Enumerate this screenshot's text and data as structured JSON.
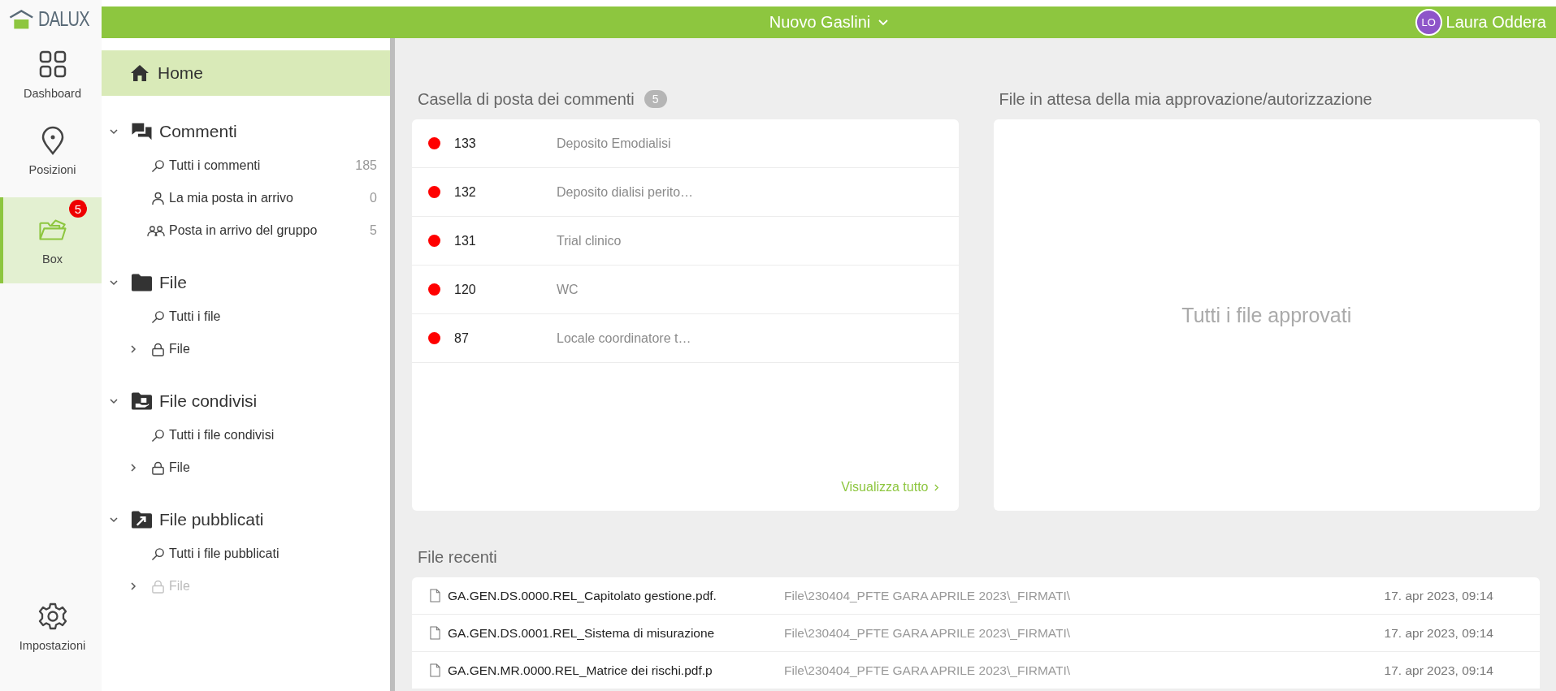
{
  "logo": "DALUX",
  "rail": {
    "items": [
      {
        "label": "Dashboard",
        "selected": false
      },
      {
        "label": "Posizioni",
        "selected": false
      },
      {
        "label": "Box",
        "selected": true,
        "badge": "5"
      }
    ],
    "settings": {
      "label": "Impostazioni"
    }
  },
  "topbar": {
    "project": "Nuovo Gaslini",
    "user": {
      "initials": "LO",
      "name": "Laura Oddera"
    }
  },
  "nav": {
    "home": {
      "label": "Home",
      "selected": true
    },
    "sections": [
      {
        "label": "Commenti",
        "expanded": true,
        "items": [
          {
            "kind": "search",
            "label": "Tutti i commenti",
            "count": "185"
          },
          {
            "kind": "person",
            "label": "La mia posta in arrivo",
            "count": "0"
          },
          {
            "kind": "group",
            "label": "Posta in arrivo del gruppo",
            "count": "5"
          }
        ]
      },
      {
        "label": "File",
        "expanded": true,
        "items": [
          {
            "kind": "search",
            "label": "Tutti i file"
          },
          {
            "kind": "folder",
            "label": "File",
            "expanded": false,
            "disabled": false
          }
        ]
      },
      {
        "label": "File condivisi",
        "expanded": true,
        "items": [
          {
            "kind": "search",
            "label": "Tutti i file condivisi"
          },
          {
            "kind": "folder",
            "label": "File",
            "expanded": false,
            "disabled": false
          }
        ]
      },
      {
        "label": "File pubblicati",
        "expanded": true,
        "items": [
          {
            "kind": "search",
            "label": "Tutti i file pubblicati"
          },
          {
            "kind": "folder",
            "label": "File",
            "expanded": false,
            "disabled": true
          }
        ]
      }
    ]
  },
  "comments": {
    "title": "Casella di posta dei commenti",
    "count": "5",
    "rows": [
      {
        "id": "133",
        "text": "Deposito Emodialisi"
      },
      {
        "id": "132",
        "text": "Deposito dialisi perito…"
      },
      {
        "id": "131",
        "text": "Trial clinico"
      },
      {
        "id": "120",
        "text": "WC"
      },
      {
        "id": "87",
        "text": "Locale coordinatore t…"
      }
    ],
    "link": "Visualizza tutto"
  },
  "approval": {
    "title": "File in attesa della mia approvazione/autorizzazione",
    "empty": "Tutti i file approvati"
  },
  "recent": {
    "title": "File recenti",
    "rows": [
      {
        "name": "GA.GEN.DS.0000.REL_Capitolato gestione.pdf.",
        "path": "File\\230404_PFTE GARA APRILE 2023\\_FIRMATI\\",
        "date": "17. apr 2023, 09:14"
      },
      {
        "name": "GA.GEN.DS.0001.REL_Sistema di misurazione",
        "path": "File\\230404_PFTE GARA APRILE 2023\\_FIRMATI\\",
        "date": "17. apr 2023, 09:14"
      },
      {
        "name": "GA.GEN.MR.0000.REL_Matrice dei rischi.pdf.p",
        "path": "File\\230404_PFTE GARA APRILE 2023\\_FIRMATI\\",
        "date": "17. apr 2023, 09:14"
      }
    ]
  }
}
